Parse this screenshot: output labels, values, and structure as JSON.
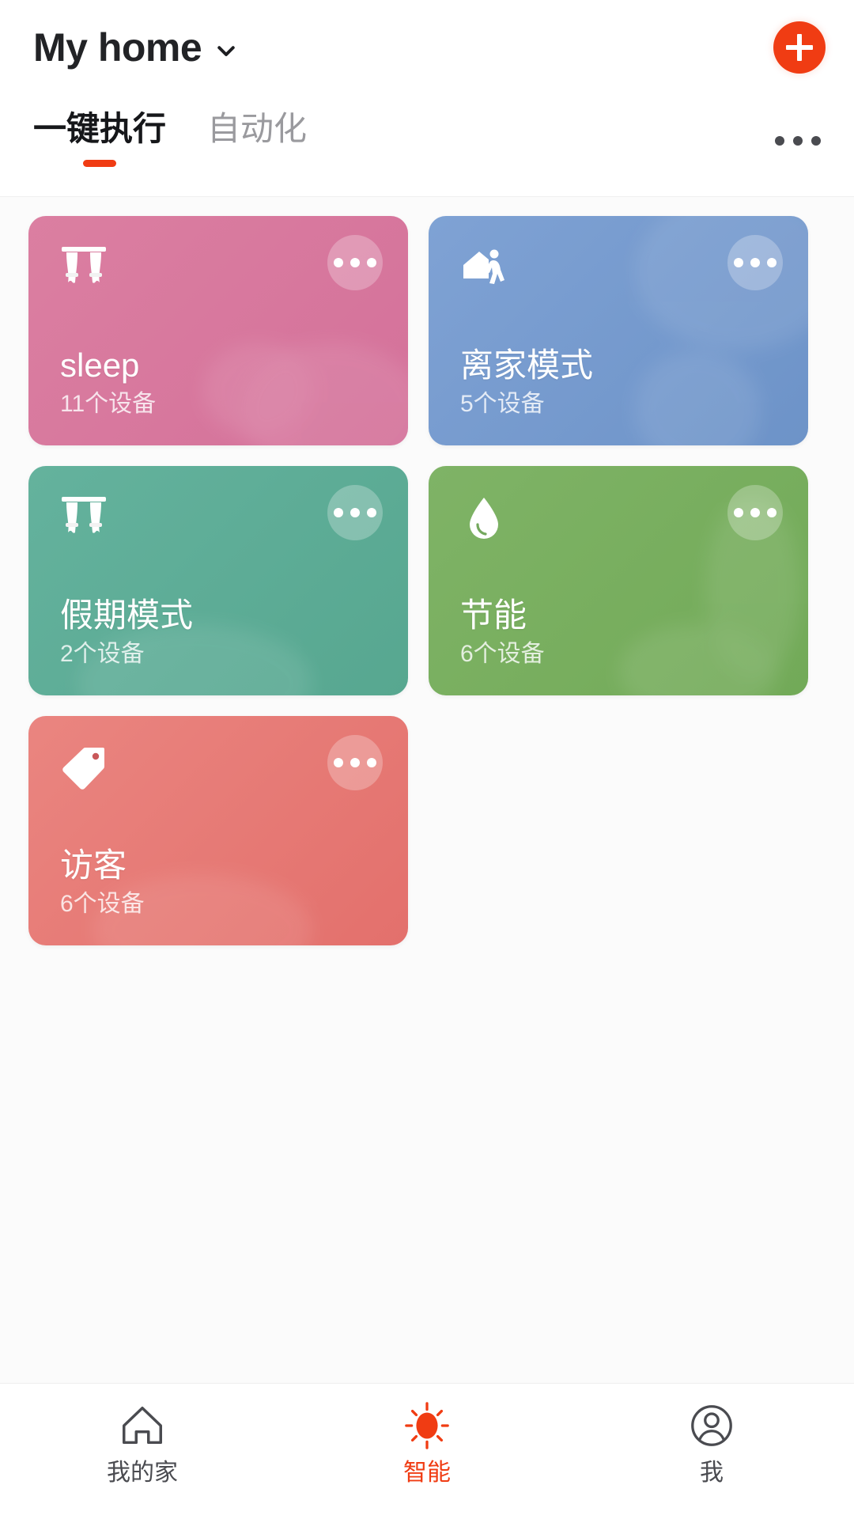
{
  "header": {
    "home_name": "My home",
    "chevron_icon": "chevron-down-icon",
    "add_icon": "plus-icon"
  },
  "tabs": {
    "items": [
      {
        "label": "一键执行",
        "active": true
      },
      {
        "label": "自动化",
        "active": false
      }
    ],
    "overflow_icon": "more-horizontal-icon",
    "active_indicator_color": "#f03c13"
  },
  "scenes": [
    {
      "name": "sleep",
      "devices": "11个设备",
      "icon": "curtains-icon",
      "color": "#d9789c",
      "color_end": "#d4729a",
      "more_icon": "more-horizontal-icon"
    },
    {
      "name": "离家模式",
      "devices": "5个设备",
      "icon": "leave-home-icon",
      "color": "#6d95cb",
      "color_end": "#7a9fd2",
      "more_icon": "more-horizontal-icon"
    },
    {
      "name": "假期模式",
      "devices": "2个设备",
      "icon": "curtains-icon",
      "color": "#5bab96",
      "color_end": "#62ae9b",
      "more_icon": "more-horizontal-icon"
    },
    {
      "name": "节能",
      "devices": "6个设备",
      "icon": "water-drop-icon",
      "color": "#76ad5c",
      "color_end": "#7cb063",
      "more_icon": "more-horizontal-icon"
    },
    {
      "name": "访客",
      "devices": "6个设备",
      "icon": "tag-icon",
      "color": "#e67b76",
      "color_end": "#e4746f",
      "more_icon": "more-horizontal-icon"
    }
  ],
  "bottom_nav": {
    "items": [
      {
        "label": "我的家",
        "icon": "house-icon",
        "active": false
      },
      {
        "label": "智能",
        "icon": "sun-icon",
        "active": true
      },
      {
        "label": "我",
        "icon": "person-circle-icon",
        "active": false
      }
    ],
    "active_color": "#f03c13",
    "inactive_color": "#4a4b50"
  }
}
